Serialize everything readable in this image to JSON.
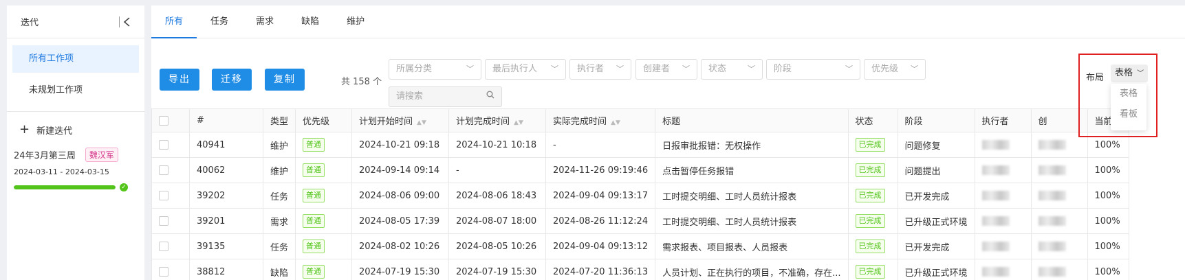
{
  "sidebar": {
    "title": "迭代",
    "items": [
      {
        "label": "所有工作项",
        "active": true
      },
      {
        "label": "未规划工作项",
        "active": false
      }
    ],
    "new_iteration_label": "新建迭代",
    "iteration": {
      "name": "24年3月第三周",
      "owner": "魏汉军",
      "dates": "2024-03-11 - 2024-03-15",
      "progress": 1.0
    }
  },
  "tabs": [
    "所有",
    "任务",
    "需求",
    "缺陷",
    "维护"
  ],
  "toolbar": {
    "export_label": "导出",
    "migrate_label": "迁移",
    "copy_label": "复制",
    "total_text": "共 158 个",
    "filters": [
      "所属分类",
      "最后执行人",
      "执行者",
      "创建者",
      "状态",
      "阶段",
      "优先级"
    ],
    "search_placeholder": "请搜索",
    "layout_label": "布局",
    "layout_value": "表格",
    "layout_options": [
      "表格",
      "看板"
    ]
  },
  "table": {
    "headers": [
      "#",
      "类型",
      "优先级",
      "计划开始时间",
      "计划完成时间",
      "实际完成时间",
      "标题",
      "状态",
      "阶段",
      "执行者",
      "创",
      "当前"
    ],
    "rows": [
      {
        "id": "40941",
        "type": "维护",
        "priority": "普通",
        "plan_start": "2024-10-21 09:18",
        "plan_end": "2024-10-21 10:18",
        "actual_end": "-",
        "title": "日报审批报错：无权操作",
        "status": "已完成",
        "stage": "问题修复",
        "executor": "",
        "creator": "",
        "current": "100%"
      },
      {
        "id": "40062",
        "type": "维护",
        "priority": "普通",
        "plan_start": "2024-09-14 09:14",
        "plan_end": "-",
        "actual_end": "2024-11-26 09:19:46",
        "title": "点击暂停任务报错",
        "status": "已完成",
        "stage": "问题提出",
        "executor": "",
        "creator": "",
        "current": "100%"
      },
      {
        "id": "39202",
        "type": "任务",
        "priority": "普通",
        "plan_start": "2024-08-06 09:00",
        "plan_end": "2024-08-06 18:43",
        "actual_end": "2024-09-04 09:13:17",
        "title": "工时提交明细、工时人员统计报表",
        "status": "已完成",
        "stage": "已开发完成",
        "executor": "",
        "creator": "",
        "current": "100%"
      },
      {
        "id": "39201",
        "type": "需求",
        "priority": "普通",
        "plan_start": "2024-08-05 17:39",
        "plan_end": "2024-08-07 18:00",
        "actual_end": "2024-08-26 11:12:24",
        "title": "工时提交明细、工时人员统计报表",
        "status": "已完成",
        "stage": "已升级正式环境",
        "executor": "",
        "creator": "",
        "current": "100%"
      },
      {
        "id": "39135",
        "type": "任务",
        "priority": "普通",
        "plan_start": "2024-08-02 10:26",
        "plan_end": "2024-08-05 10:26",
        "actual_end": "2024-09-04 09:13:12",
        "title": "需求报表、项目报表、人员报表",
        "status": "已完成",
        "stage": "已开发完成",
        "executor": "",
        "creator": "",
        "current": "100%"
      },
      {
        "id": "38812",
        "type": "缺陷",
        "priority": "普通",
        "plan_start": "2024-07-19 15:30",
        "plan_end": "2024-07-19 15:30",
        "actual_end": "2024-07-20 11:36:13",
        "title": "人员计划、正在执行的项目，不准确，存在...",
        "status": "已完成",
        "stage": "已升级正式环境",
        "executor": "",
        "creator": "",
        "current": "100%"
      }
    ]
  }
}
